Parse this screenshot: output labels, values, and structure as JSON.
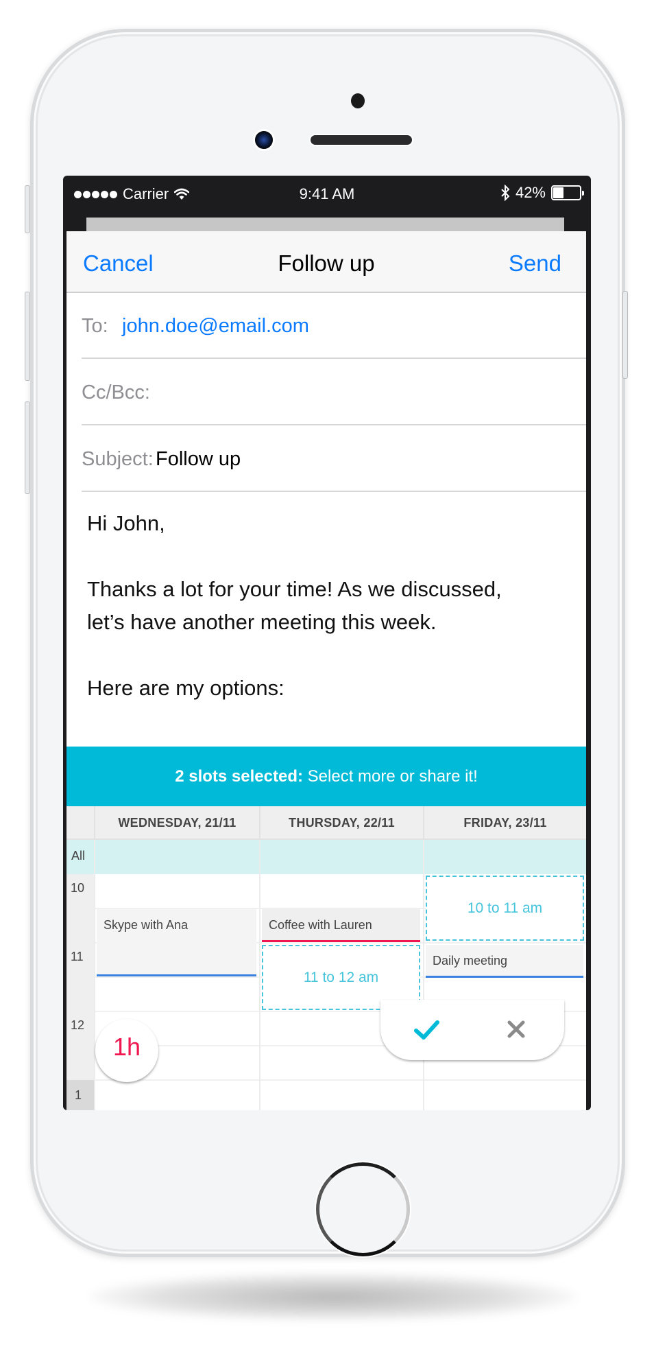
{
  "status_bar": {
    "carrier": "Carrier",
    "time": "9:41 AM",
    "battery_percent_label": "42%",
    "battery_level": 0.42,
    "signal_bars": 5,
    "icons": [
      "signal-dots-icon",
      "wifi-icon",
      "bluetooth-icon",
      "battery-icon"
    ]
  },
  "compose": {
    "nav": {
      "cancel_label": "Cancel",
      "title": "Follow up",
      "send_label": "Send"
    },
    "fields": {
      "to_label": "To:",
      "to_value": "john.doe@email.com",
      "cc_label": "Cc/Bcc:",
      "cc_value": "",
      "subject_label": "Subject:",
      "subject_value": "Follow up"
    },
    "body": {
      "greeting": "Hi John,",
      "line1": "Thanks a lot for your time! As we discussed,",
      "line2": "let’s have another meeting this week.",
      "line3": "Here are my options:"
    }
  },
  "scheduler": {
    "banner": {
      "bold": "2 slots selected:",
      "rest": " Select more or share it!"
    },
    "days": [
      "WEDNESDAY, 21/11",
      "THURSDAY, 22/11",
      "FRIDAY, 23/11"
    ],
    "all_day_label": "All",
    "hours": [
      "10",
      "11",
      "12",
      "1"
    ],
    "events": [
      {
        "title": "Skype with Ana",
        "day": "WEDNESDAY, 21/11",
        "accent": "#3b82e0"
      },
      {
        "title": "Coffee with Lauren",
        "day": "THURSDAY, 22/11",
        "accent": "#f0164f"
      },
      {
        "title": "Daily meeting",
        "day": "FRIDAY, 23/11",
        "accent": "#3b82e0"
      }
    ],
    "selected_slots": [
      {
        "label": "10 to 11 am",
        "day": "FRIDAY, 23/11"
      },
      {
        "label": "11 to 12 am",
        "day": "THURSDAY, 22/11"
      }
    ],
    "duration_label": "1h",
    "actions": {
      "confirm_icon": "checkmark-icon",
      "dismiss_icon": "close-icon"
    },
    "colors": {
      "banner": "#00bad7",
      "slot": "#45c4dc",
      "duration": "#f0164f",
      "link": "#0a7aff"
    }
  }
}
